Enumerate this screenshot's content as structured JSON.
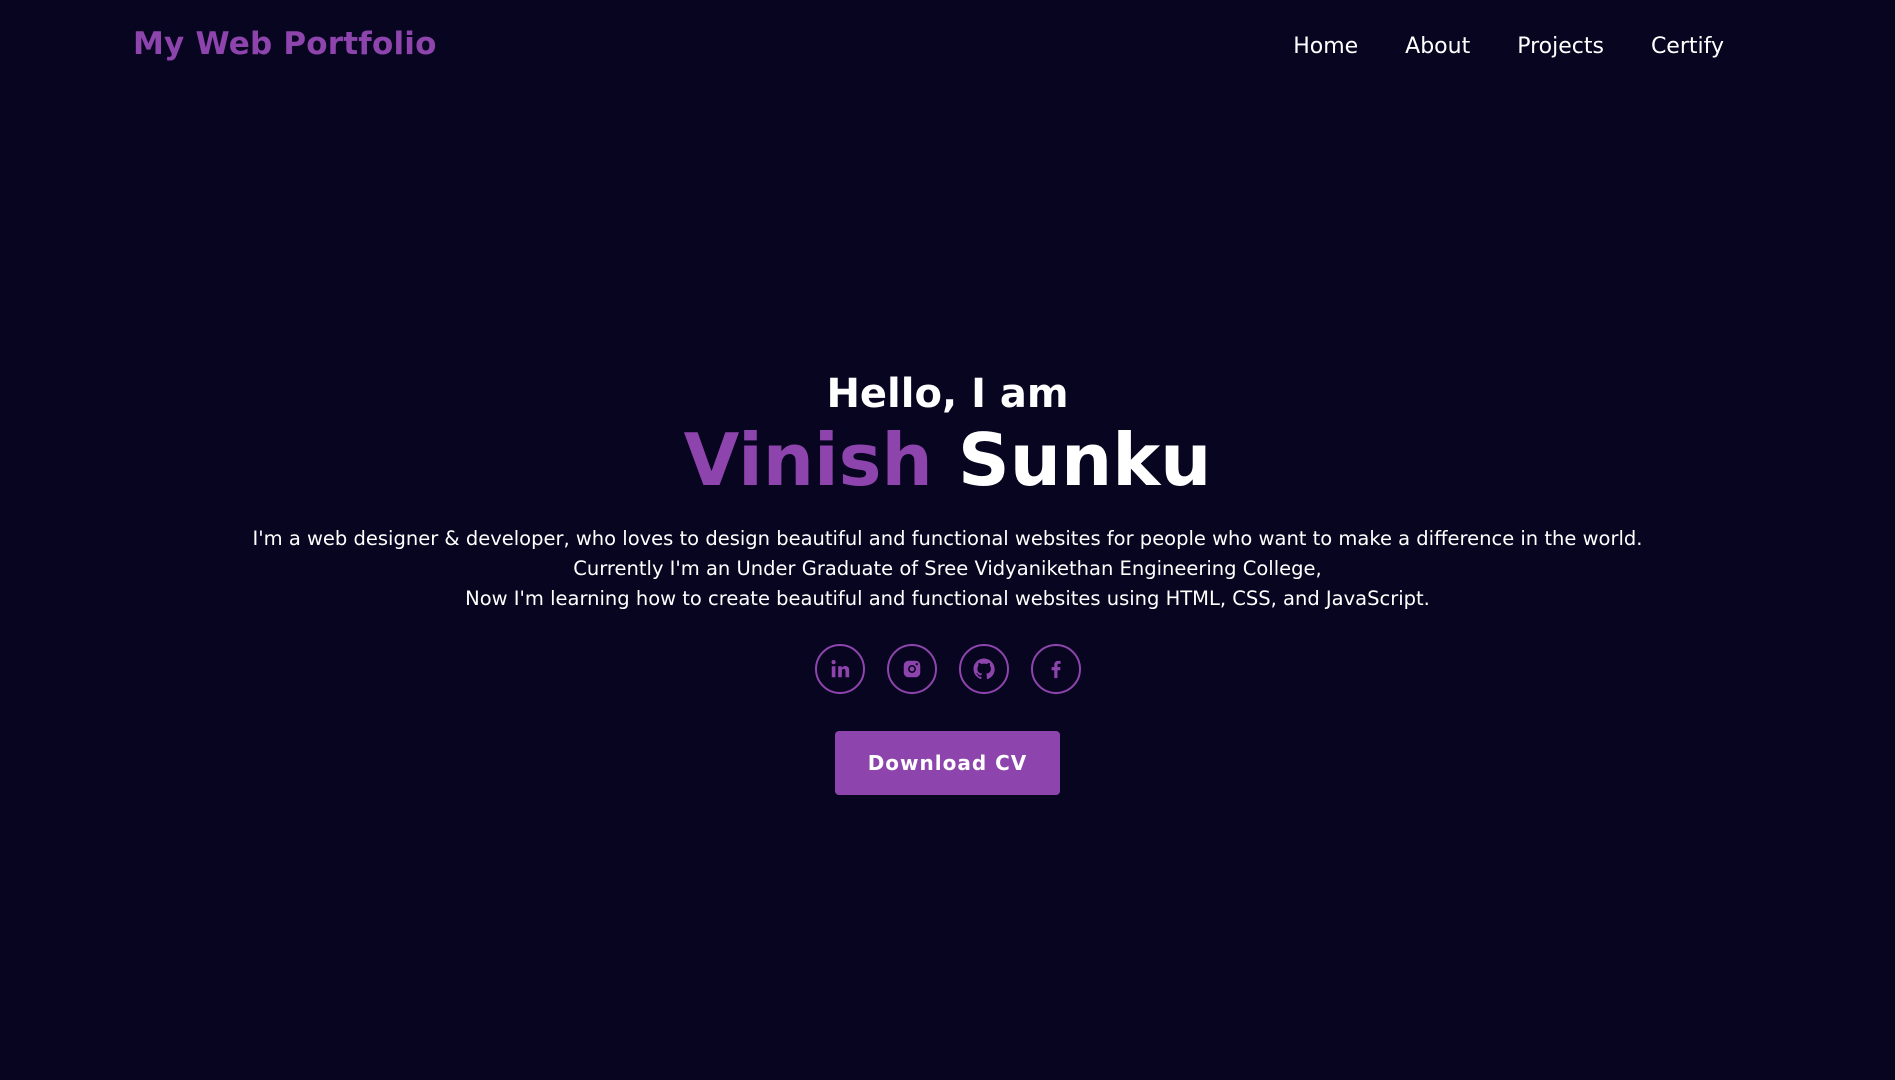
{
  "header": {
    "brand": "My Web Portfolio",
    "nav": [
      "Home",
      "About",
      "Projects",
      "Certify"
    ]
  },
  "hero": {
    "greeting": "Hello, I am",
    "first_name": "Vinish",
    "last_name": "Sunku",
    "bio": [
      "I'm a web designer & developer, who loves to design beautiful and functional websites for people who want to make a difference in the world.",
      "Currently I'm an Under Graduate of Sree Vidyanikethan Engineering College,",
      "Now I'm learning how to create beautiful and functional websites using HTML, CSS, and JavaScript."
    ],
    "socials": [
      "linkedin-icon",
      "instagram-icon",
      "github-icon",
      "facebook-icon"
    ],
    "cta_label": "Download CV"
  },
  "colors": {
    "background": "#080520",
    "accent": "#8e44ad",
    "text": "#ffffff"
  }
}
